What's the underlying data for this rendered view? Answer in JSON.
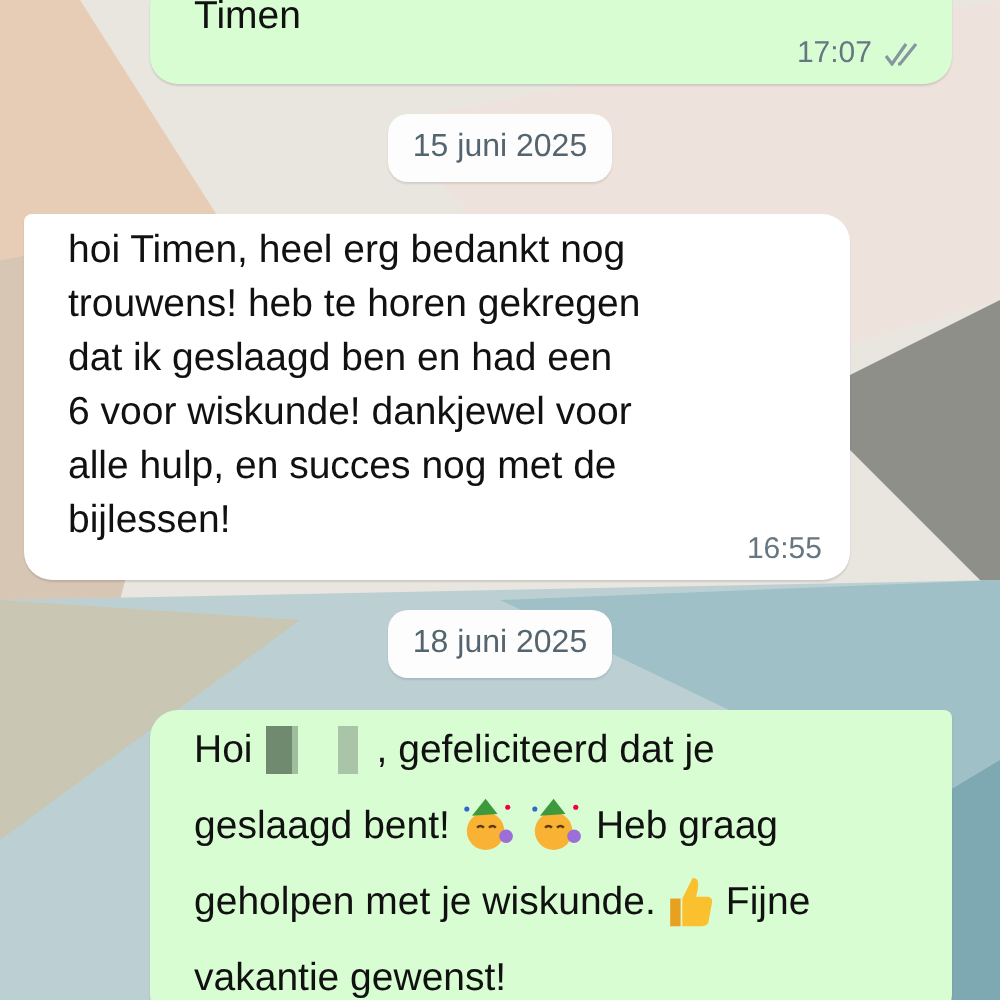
{
  "messages": [
    {
      "kind": "message",
      "outgoing": true,
      "lines": [
        "Timen"
      ],
      "time": "17:07",
      "read": false
    },
    {
      "kind": "date",
      "label": "15 juni 2025"
    },
    {
      "kind": "message",
      "outgoing": false,
      "lines": [
        "hoi Timen, heel erg bedankt nog",
        "trouwens! heb te horen gekregen",
        "dat ik geslaagd ben en had een",
        "6 voor wiskunde! dankjewel voor",
        "alle hulp, en succes nog met de",
        "bijlessen!"
      ],
      "time": "16:55"
    },
    {
      "kind": "date",
      "label": "18 juni 2025"
    },
    {
      "kind": "message",
      "outgoing": true,
      "segments": [
        {
          "kind": "text",
          "text": "Hoi"
        },
        {
          "kind": "redacted"
        },
        {
          "kind": "text",
          "text": ", gefeliciteerd dat je"
        },
        {
          "kind": "break"
        },
        {
          "kind": "text",
          "text": "geslaagd bent!"
        },
        {
          "kind": "party"
        },
        {
          "kind": "party"
        },
        {
          "kind": "text",
          "text": "Heb graag"
        },
        {
          "kind": "break"
        },
        {
          "kind": "text",
          "text": "geholpen met je wiskunde."
        },
        {
          "kind": "thumbsup"
        },
        {
          "kind": "text",
          "text": "Fijne"
        },
        {
          "kind": "break"
        },
        {
          "kind": "text",
          "text": "vakantie gewenst!"
        }
      ]
    }
  ]
}
